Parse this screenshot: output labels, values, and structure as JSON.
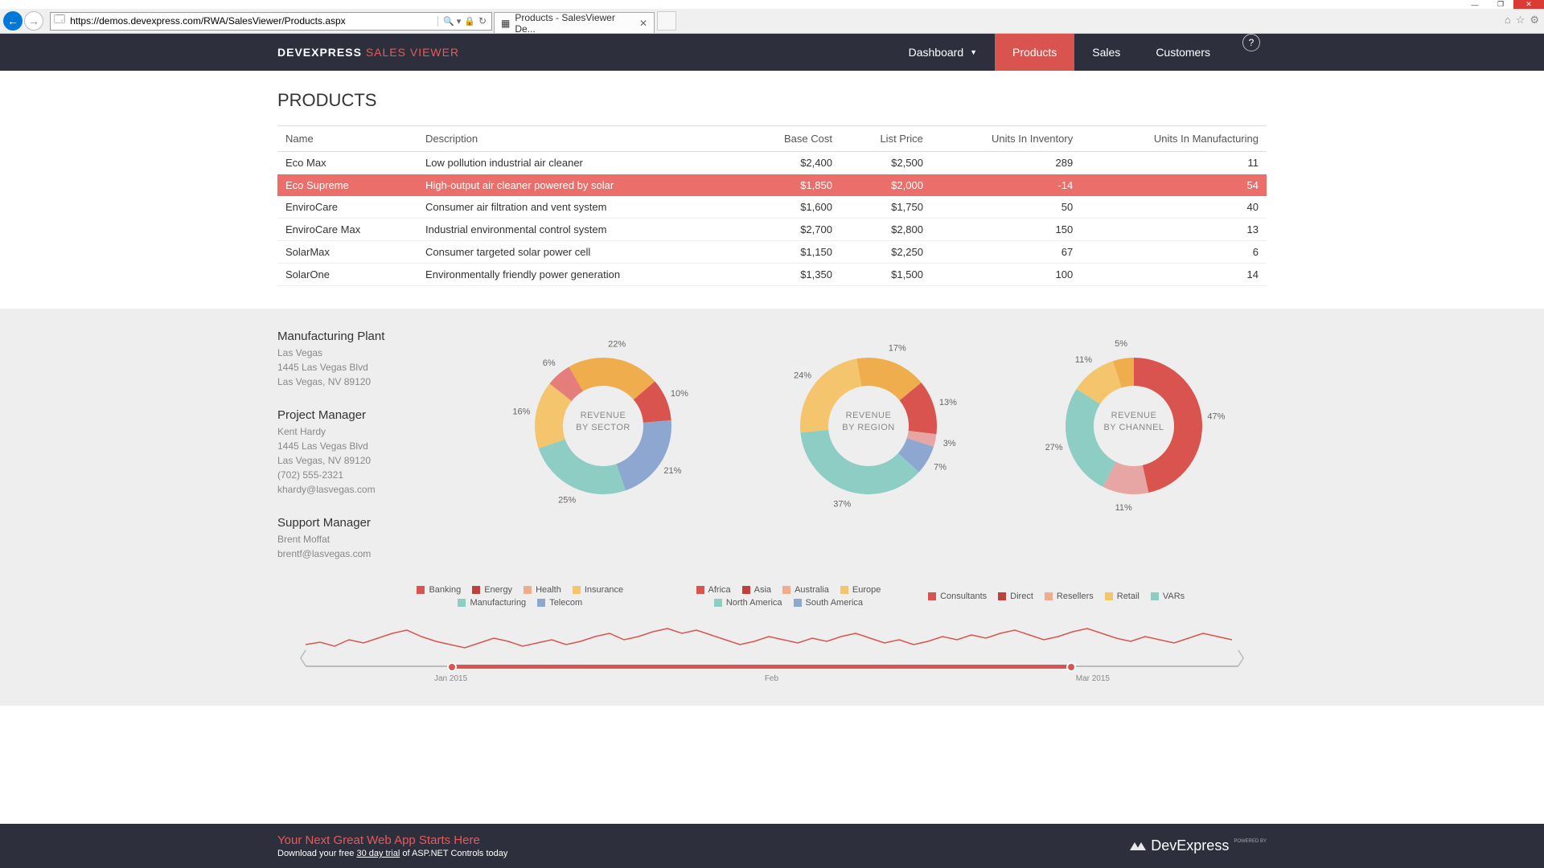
{
  "browser": {
    "url": "https://demos.devexpress.com/RWA/SalesViewer/Products.aspx",
    "tab_title": "Products - SalesViewer De..."
  },
  "header": {
    "brand_left": "DEVEXPRESS",
    "brand_right": "SALES VIEWER",
    "nav": [
      "Dashboard",
      "Products",
      "Sales",
      "Customers"
    ],
    "active_index": 1,
    "help": "?"
  },
  "page_title": "PRODUCTS",
  "table": {
    "columns": [
      "Name",
      "Description",
      "Base Cost",
      "List Price",
      "Units In Inventory",
      "Units In Manufacturing"
    ],
    "rows": [
      {
        "name": "Eco Max",
        "desc": "Low pollution industrial air cleaner",
        "base": "$2,400",
        "list": "$2,500",
        "inv": "289",
        "mfg": "11",
        "selected": false
      },
      {
        "name": "Eco Supreme",
        "desc": "High-output air cleaner powered by solar",
        "base": "$1,850",
        "list": "$2,000",
        "inv": "-14",
        "mfg": "54",
        "selected": true
      },
      {
        "name": "EnviroCare",
        "desc": "Consumer air filtration and vent system",
        "base": "$1,600",
        "list": "$1,750",
        "inv": "50",
        "mfg": "40",
        "selected": false
      },
      {
        "name": "EnviroCare Max",
        "desc": "Industrial environmental control system",
        "base": "$2,700",
        "list": "$2,800",
        "inv": "150",
        "mfg": "13",
        "selected": false
      },
      {
        "name": "SolarMax",
        "desc": "Consumer targeted solar power cell",
        "base": "$1,150",
        "list": "$2,250",
        "inv": "67",
        "mfg": "6",
        "selected": false
      },
      {
        "name": "SolarOne",
        "desc": "Environmentally friendly power generation",
        "base": "$1,350",
        "list": "$1,500",
        "inv": "100",
        "mfg": "14",
        "selected": false
      }
    ]
  },
  "info": {
    "plant": {
      "title": "Manufacturing Plant",
      "lines": [
        "Las Vegas",
        "1445 Las Vegas Blvd",
        "Las Vegas, NV 89120"
      ]
    },
    "pm": {
      "title": "Project Manager",
      "lines": [
        "Kent Hardy",
        "1445 Las Vegas Blvd",
        "Las Vegas, NV 89120",
        "(702) 555-2321",
        "khardy@lasvegas.com"
      ]
    },
    "sm": {
      "title": "Support Manager",
      "lines": [
        "Brent Moffat",
        "brentf@lasvegas.com"
      ]
    }
  },
  "chart_data": [
    {
      "type": "pie",
      "title": "REVENUE BY SECTOR",
      "series": [
        {
          "name": "Banking",
          "value": 22,
          "color": "#f0ad4e"
        },
        {
          "name": "Energy",
          "value": 10,
          "color": "#d9534f"
        },
        {
          "name": "Health",
          "value": 21,
          "color": "#8ea7d0"
        },
        {
          "name": "Insurance",
          "value": 25,
          "color": "#8ecdc3"
        },
        {
          "name": "Manufacturing",
          "value": 16,
          "color": "#f5c56e"
        },
        {
          "name": "Telecom",
          "value": 6,
          "color": "#e57e7a"
        }
      ]
    },
    {
      "type": "pie",
      "title": "REVENUE BY REGION",
      "series": [
        {
          "name": "Africa",
          "value": 17,
          "color": "#f0ad4e"
        },
        {
          "name": "Asia",
          "value": 13,
          "color": "#d9534f"
        },
        {
          "name": "Australia",
          "value": 3,
          "color": "#e7a5a3"
        },
        {
          "name": "Europe",
          "value": 7,
          "color": "#8ea7d0"
        },
        {
          "name": "North America",
          "value": 37,
          "color": "#8ecdc3"
        },
        {
          "name": "South America",
          "value": 24,
          "color": "#f5c56e"
        }
      ]
    },
    {
      "type": "pie",
      "title": "REVENUE BY CHANNEL",
      "series": [
        {
          "name": "Consultants",
          "value": 47,
          "color": "#d9534f"
        },
        {
          "name": "Direct",
          "value": 11,
          "color": "#e7a5a3"
        },
        {
          "name": "Resellers",
          "value": 27,
          "color": "#8ecdc3"
        },
        {
          "name": "Retail",
          "value": 11,
          "color": "#f5c56e"
        },
        {
          "name": "VARs",
          "value": 5,
          "color": "#f0ad4e"
        }
      ]
    }
  ],
  "sparkline_labels": [
    "Jan 2015",
    "Feb",
    "Mar 2015"
  ],
  "legends": [
    [
      {
        "name": "Banking",
        "color": "#d9534f"
      },
      {
        "name": "Energy",
        "color": "#c0403c"
      },
      {
        "name": "Health",
        "color": "#f0ad8e"
      },
      {
        "name": "Insurance",
        "color": "#f5c56e"
      },
      {
        "name": "Manufacturing",
        "color": "#8ecdc3"
      },
      {
        "name": "Telecom",
        "color": "#8ea7d0"
      }
    ],
    [
      {
        "name": "Africa",
        "color": "#d9534f"
      },
      {
        "name": "Asia",
        "color": "#c0403c"
      },
      {
        "name": "Australia",
        "color": "#f0ad8e"
      },
      {
        "name": "Europe",
        "color": "#f5c56e"
      },
      {
        "name": "North America",
        "color": "#8ecdc3"
      },
      {
        "name": "South America",
        "color": "#8ea7d0"
      }
    ],
    [
      {
        "name": "Consultants",
        "color": "#d9534f"
      },
      {
        "name": "Direct",
        "color": "#c0403c"
      },
      {
        "name": "Resellers",
        "color": "#f0ad8e"
      },
      {
        "name": "Retail",
        "color": "#f5c56e"
      },
      {
        "name": "VARs",
        "color": "#8ecdc3"
      }
    ]
  ],
  "footer": {
    "headline": "Your Next Great Web App Starts Here",
    "sub_left": "Download your free ",
    "sub_link": "30 day trial",
    "sub_right": " of ASP.NET Controls today",
    "logo_text": "DevExpress",
    "powered": "POWERED BY"
  }
}
